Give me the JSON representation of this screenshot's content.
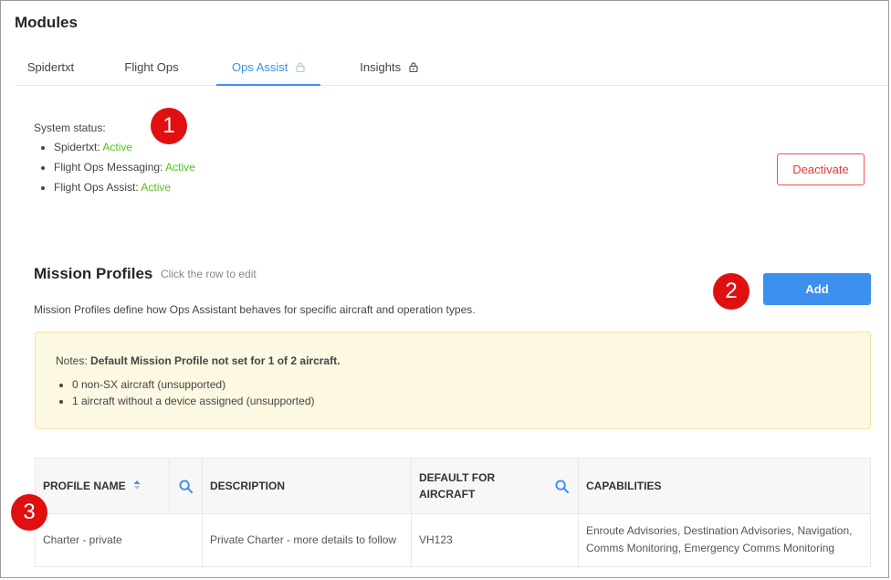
{
  "page": {
    "title": "Modules"
  },
  "tabs": [
    {
      "label": "Spidertxt",
      "locked": false,
      "active": false
    },
    {
      "label": "Flight Ops",
      "locked": false,
      "active": false
    },
    {
      "label": "Ops Assist",
      "locked": true,
      "active": true
    },
    {
      "label": "Insights",
      "locked": true,
      "active": false
    }
  ],
  "system_status": {
    "label": "System status:",
    "items": [
      {
        "name": "Spidertxt:",
        "state": "Active"
      },
      {
        "name": "Flight Ops Messaging:",
        "state": "Active"
      },
      {
        "name": "Flight Ops Assist:",
        "state": "Active"
      }
    ],
    "deactivate_label": "Deactivate"
  },
  "mission_profiles": {
    "title": "Mission Profiles",
    "hint": "Click the row to edit",
    "description": "Mission Profiles define how Ops Assistant behaves for specific aircraft and operation types.",
    "add_label": "Add"
  },
  "notes": {
    "prefix": "Notes:",
    "headline": "Default Mission Profile not set for 1 of 2 aircraft.",
    "items": [
      "0 non-SX aircraft (unsupported)",
      "1 aircraft without a device assigned (unsupported)"
    ]
  },
  "table": {
    "columns": {
      "profile_name": "PROFILE NAME",
      "description": "DESCRIPTION",
      "default_for_aircraft_line1": "DEFAULT FOR",
      "default_for_aircraft_line2": "AIRCRAFT",
      "capabilities": "CAPABILITIES"
    },
    "rows": [
      {
        "profile_name": "Charter - private",
        "description": "Private Charter - more details to follow",
        "default_for_aircraft": "VH123",
        "capabilities": "Enroute Advisories, Destination Advisories, Navigation, Comms Monitoring, Emergency Comms Monitoring"
      }
    ]
  },
  "markers": [
    "1",
    "2",
    "3"
  ],
  "colors": {
    "accent": "#3d8ff0",
    "active_green": "#52c41a",
    "danger": "#e53935",
    "marker_red": "#e01010",
    "notes_bg": "#fdf8e2"
  },
  "icons": {
    "tab_lock": "lock-icon",
    "column_search": "search-icon",
    "sort": "sort-icon"
  }
}
